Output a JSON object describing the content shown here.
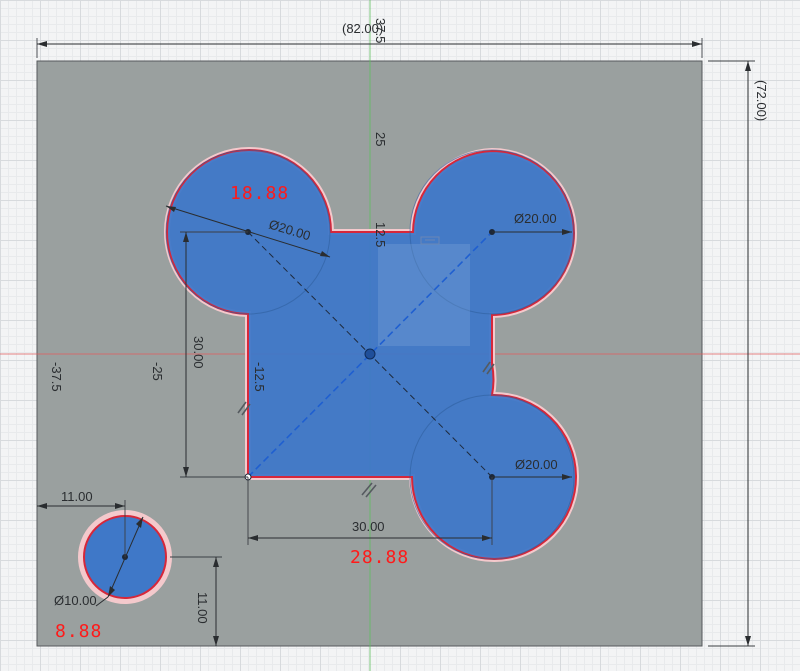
{
  "sketch": {
    "colors": {
      "plate": "#9aa09f",
      "profile_fill": "#3f78c8",
      "profile_edge": "#d6273a",
      "axis_x": "#e25c5c",
      "axis_y": "#5fbf5f"
    },
    "overall_width": "(82.00)",
    "overall_height": "(72.00)",
    "axis_labels": {
      "top_37_5": "37.5",
      "y_25": "25",
      "y_12_5": "12.5",
      "left_37_5": "-37.5",
      "left_25": "-25",
      "left_12_5": "-12.5"
    },
    "dimensions": {
      "top_left_diameter": "Ø20.00",
      "top_right_diameter": "Ø20.00",
      "bottom_right_diameter": "Ø20.00",
      "square_height": "30.00",
      "square_width": "30.00",
      "small_hole_offset_x": "11.00",
      "small_hole_offset_y": "11.00",
      "small_hole_diameter": "Ø10.00"
    },
    "red_labels": {
      "top": "18.88",
      "bottom": "28.88",
      "small": "8.88"
    }
  }
}
